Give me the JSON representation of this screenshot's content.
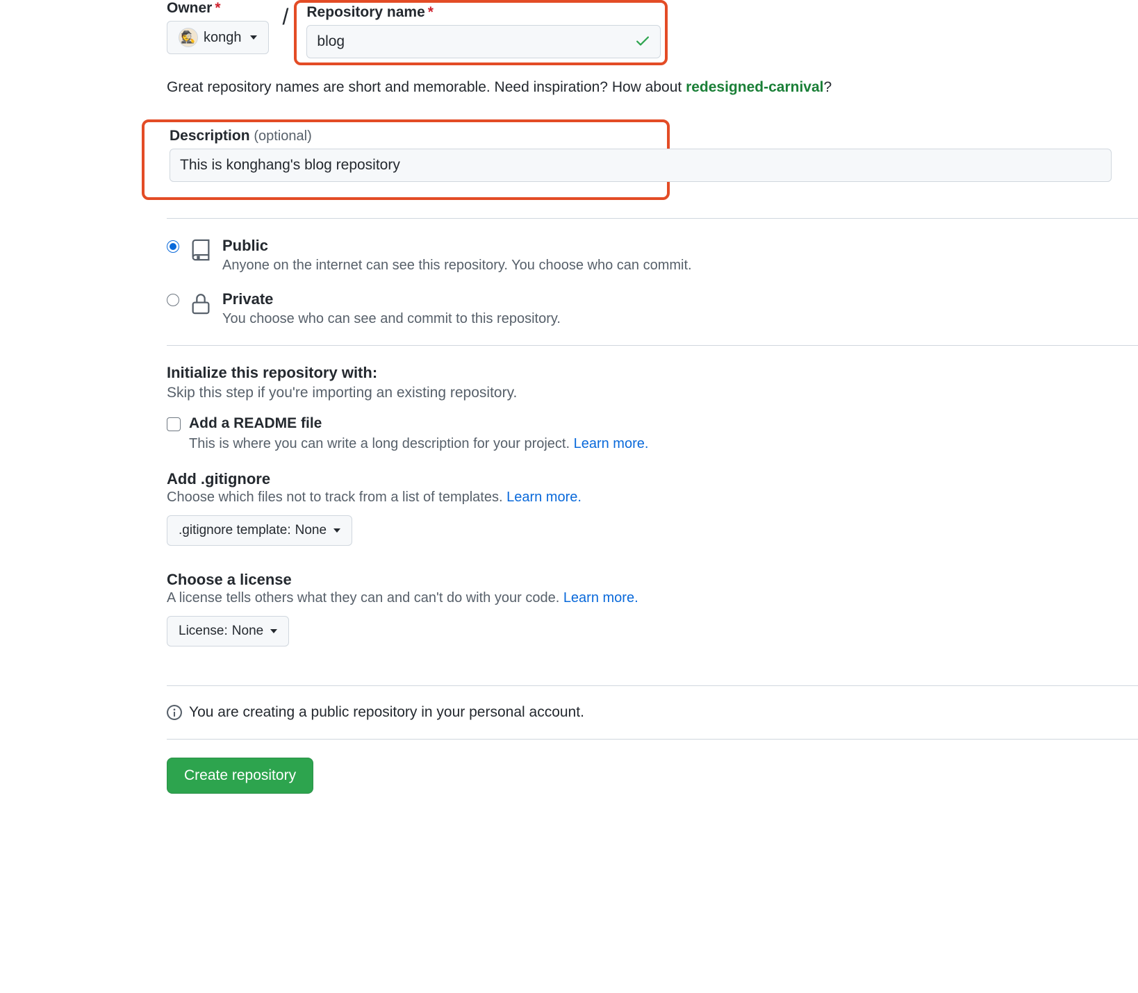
{
  "labels": {
    "owner": "Owner",
    "repo_name": "Repository name",
    "description": "Description",
    "optional": "(optional)"
  },
  "owner": {
    "username": "kongh"
  },
  "repo": {
    "name": "blog"
  },
  "hint": {
    "text1": "Great repository names are short and memorable. Need inspiration? How about ",
    "suggestion": "redesigned-carnival",
    "qmark": "?"
  },
  "description": {
    "value": "This is konghang's blog repository"
  },
  "visibility": {
    "public": {
      "title": "Public",
      "desc": "Anyone on the internet can see this repository. You choose who can commit."
    },
    "private": {
      "title": "Private",
      "desc": "You choose who can see and commit to this repository."
    }
  },
  "init": {
    "heading": "Initialize this repository with:",
    "sub": "Skip this step if you're importing an existing repository.",
    "readme_label": "Add a README file",
    "readme_desc": "This is where you can write a long description for your project. ",
    "learn_more": "Learn more."
  },
  "gitignore": {
    "heading": "Add .gitignore",
    "desc": "Choose which files not to track from a list of templates. ",
    "button_prefix": ".gitignore template: ",
    "button_value": "None"
  },
  "license": {
    "heading": "Choose a license",
    "desc": "A license tells others what they can and can't do with your code. ",
    "button_prefix": "License: ",
    "button_value": "None"
  },
  "info": "You are creating a public repository in your personal account.",
  "submit": "Create repository"
}
